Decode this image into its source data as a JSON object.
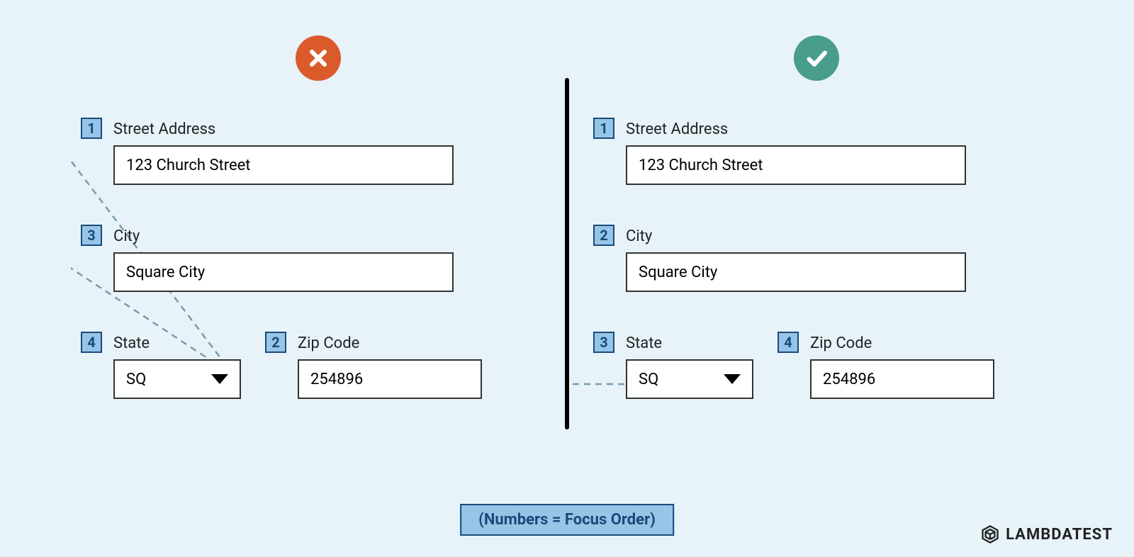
{
  "legend": "(Numbers = Focus Order)",
  "brand": "LAMBDATEST",
  "left": {
    "status": "bad",
    "fields": {
      "street": {
        "num": "1",
        "label": "Street Address",
        "value": "123 Church Street"
      },
      "city": {
        "num": "3",
        "label": "City",
        "value": "Square City"
      },
      "state": {
        "num": "4",
        "label": "State",
        "value": "SQ"
      },
      "zip": {
        "num": "2",
        "label": "Zip Code",
        "value": "254896"
      }
    }
  },
  "right": {
    "status": "good",
    "fields": {
      "street": {
        "num": "1",
        "label": "Street Address",
        "value": "123 Church Street"
      },
      "city": {
        "num": "2",
        "label": "City",
        "value": "Square City"
      },
      "state": {
        "num": "3",
        "label": "State",
        "value": "SQ"
      },
      "zip": {
        "num": "4",
        "label": "Zip Code",
        "value": "254896"
      }
    }
  }
}
